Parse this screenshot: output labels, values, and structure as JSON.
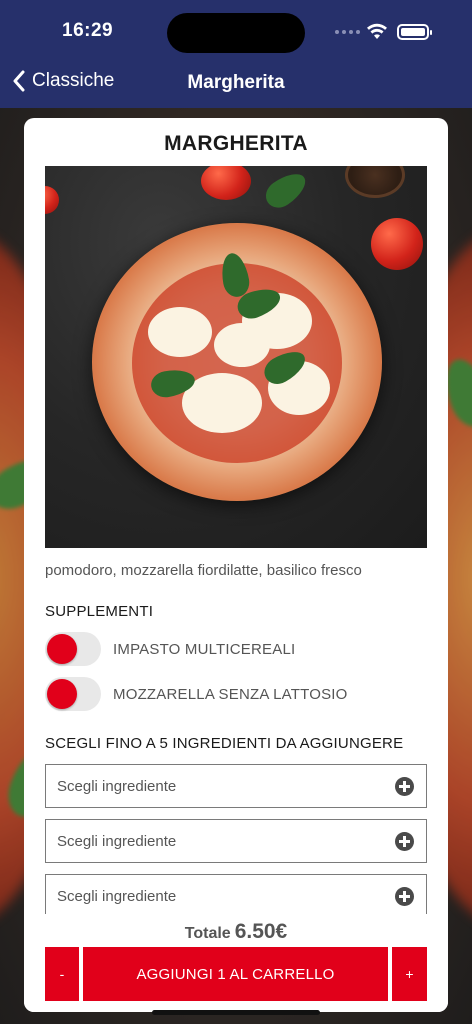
{
  "status_bar": {
    "time": "16:29"
  },
  "nav": {
    "back_label": "Classiche",
    "title": "Margherita"
  },
  "product": {
    "name": "MARGHERITA",
    "image_alt": "Pizza Margherita",
    "description": "pomodoro, mozzarella fiordilatte, basilico fresco"
  },
  "supplements": {
    "heading": "SUPPLEMENTI",
    "items": [
      {
        "label": "IMPASTO MULTICEREALI"
      },
      {
        "label": "MOZZARELLA SENZA LATTOSIO"
      }
    ]
  },
  "ingredients": {
    "heading": "SCEGLI FINO A 5 INGREDIENTI DA AGGIUNGERE",
    "selects": [
      {
        "placeholder": "Scegli ingrediente"
      },
      {
        "placeholder": "Scegli ingrediente"
      },
      {
        "placeholder": "Scegli ingrediente"
      }
    ]
  },
  "footer": {
    "total_label": "Totale",
    "total_amount": "6.50€",
    "minus_label": "-",
    "add_label": "AGGIUNGI 1 AL CARRELLO",
    "plus_label": "+"
  },
  "colors": {
    "nav_bg": "#26306b",
    "accent": "#e1001a"
  },
  "icons": [
    "chevron-left-icon",
    "wifi-icon",
    "battery-icon",
    "plus-circle-icon"
  ]
}
